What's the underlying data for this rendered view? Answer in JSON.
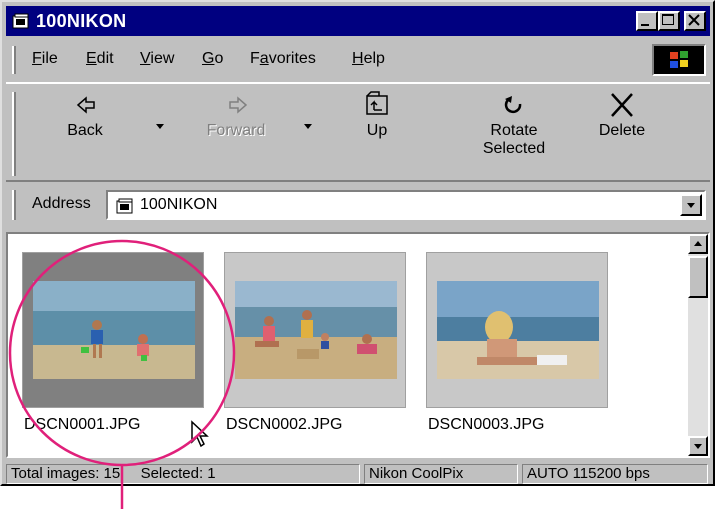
{
  "window": {
    "title": "100NIKON"
  },
  "menu": {
    "items": [
      "File",
      "Edit",
      "View",
      "Go",
      "Favorites",
      "Help"
    ],
    "accel": [
      "F",
      "E",
      "V",
      "G",
      "a",
      "H"
    ]
  },
  "toolbar": {
    "back": "Back",
    "forward": "Forward",
    "up": "Up",
    "rotate_line1": "Rotate",
    "rotate_line2": "Selected",
    "delete": "Delete"
  },
  "address": {
    "label": "Address",
    "value": "100NIKON"
  },
  "files": [
    {
      "name": "DSCN0001.JPG",
      "selected": true
    },
    {
      "name": "DSCN0002.JPG",
      "selected": false
    },
    {
      "name": "DSCN0003.JPG",
      "selected": false
    }
  ],
  "status": {
    "total_images": "Total images: 15",
    "selected": "Selected: 1",
    "camera": "Nikon CoolPix",
    "speed": "AUTO  115200 bps"
  },
  "colors": {
    "titlebar": "#000080",
    "face": "#c0c0c0",
    "annotation": "#e0207a"
  }
}
